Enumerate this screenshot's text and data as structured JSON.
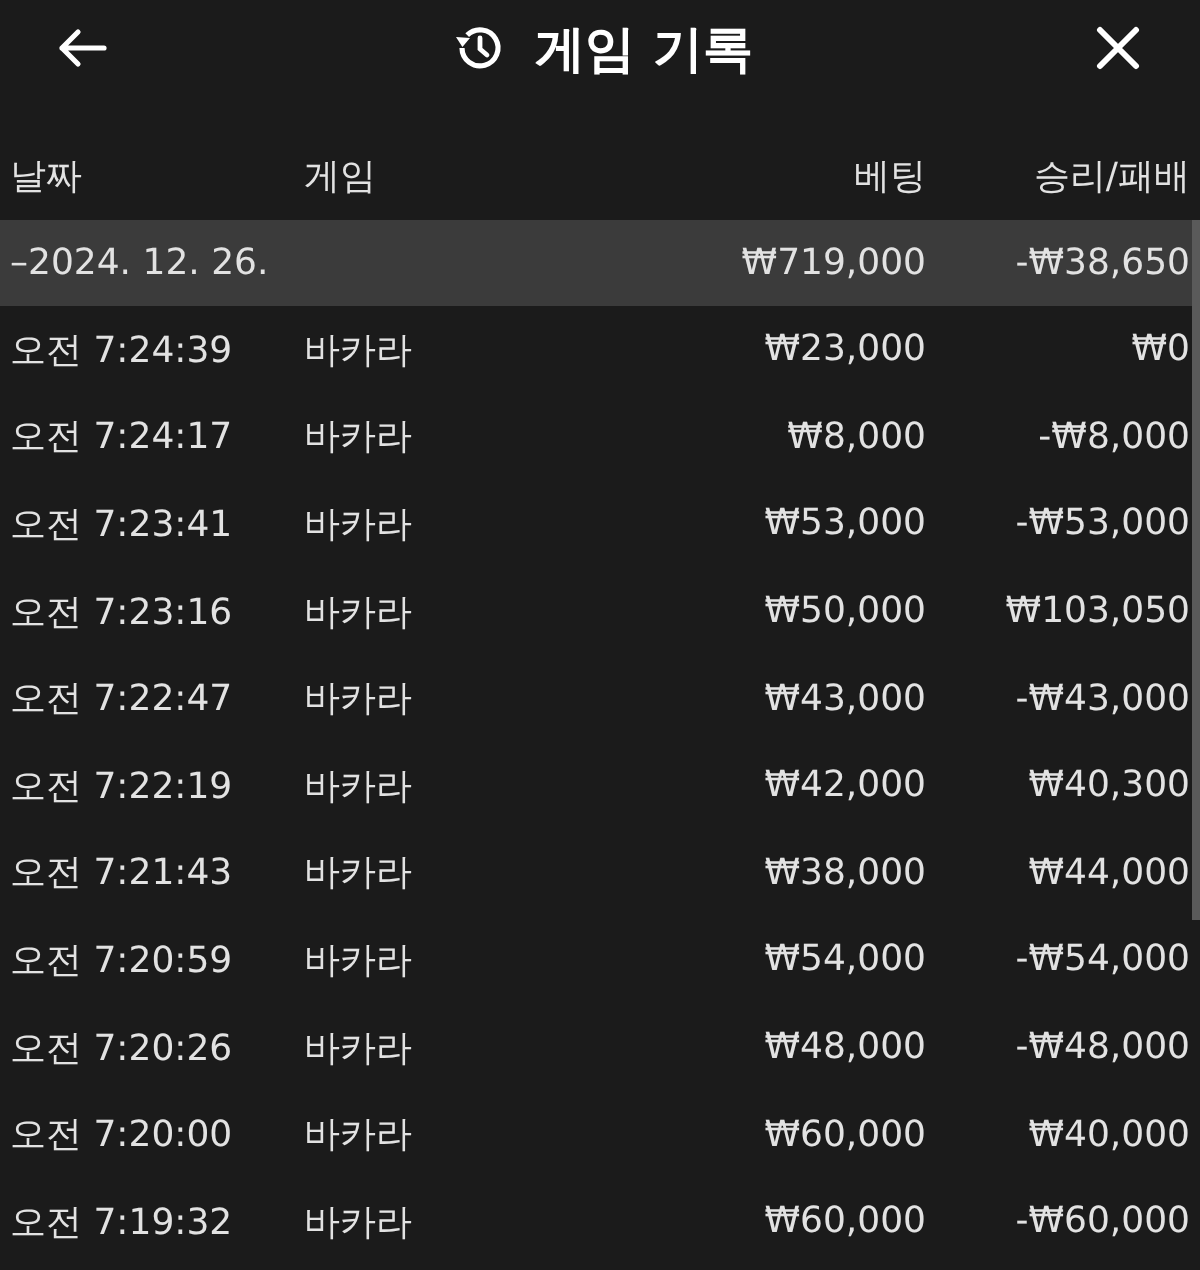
{
  "header": {
    "title": "게임 기록"
  },
  "table": {
    "columns": [
      "날짜",
      "게임",
      "베팅",
      "승리/패배"
    ],
    "group": {
      "date": "–2024. 12. 26.",
      "bet": "₩719,000",
      "result": "-₩38,650"
    },
    "rows": [
      {
        "time": "오전 7:24:39",
        "game": "바카라",
        "bet": "₩23,000",
        "result": "₩0"
      },
      {
        "time": "오전 7:24:17",
        "game": "바카라",
        "bet": "₩8,000",
        "result": "-₩8,000"
      },
      {
        "time": "오전 7:23:41",
        "game": "바카라",
        "bet": "₩53,000",
        "result": "-₩53,000"
      },
      {
        "time": "오전 7:23:16",
        "game": "바카라",
        "bet": "₩50,000",
        "result": "₩103,050"
      },
      {
        "time": "오전 7:22:47",
        "game": "바카라",
        "bet": "₩43,000",
        "result": "-₩43,000"
      },
      {
        "time": "오전 7:22:19",
        "game": "바카라",
        "bet": "₩42,000",
        "result": "₩40,300"
      },
      {
        "time": "오전 7:21:43",
        "game": "바카라",
        "bet": "₩38,000",
        "result": "₩44,000"
      },
      {
        "time": "오전 7:20:59",
        "game": "바카라",
        "bet": "₩54,000",
        "result": "-₩54,000"
      },
      {
        "time": "오전 7:20:26",
        "game": "바카라",
        "bet": "₩48,000",
        "result": "-₩48,000"
      },
      {
        "time": "오전 7:20:00",
        "game": "바카라",
        "bet": "₩60,000",
        "result": "₩40,000"
      },
      {
        "time": "오전 7:19:32",
        "game": "바카라",
        "bet": "₩60,000",
        "result": "-₩60,000"
      }
    ]
  }
}
